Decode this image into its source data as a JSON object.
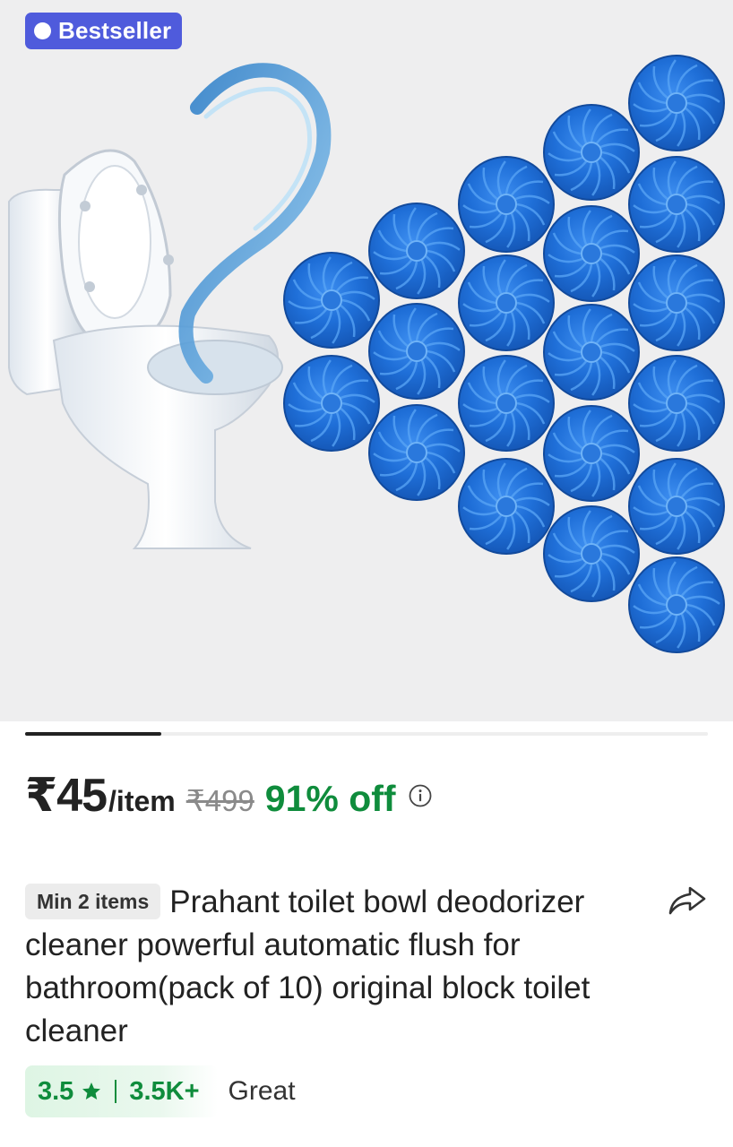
{
  "badge": {
    "label": "Bestseller",
    "icon": "verified-check-icon",
    "color": "#4f5bdc"
  },
  "gallery": {
    "current_index": 1,
    "image_count": 5
  },
  "price": {
    "current": "₹45",
    "unit": "/item",
    "mrp": "₹499",
    "discount": "91% off",
    "info_icon": "info-icon",
    "discount_color": "#0f8c3c"
  },
  "product": {
    "min_qty_label": "Min 2 items",
    "title": "Prahant toilet bowl deodorizer cleaner powerful automatic flush for bathroom(pack of 10) original block toilet cleaner",
    "share_icon": "share-icon"
  },
  "rating": {
    "score": "3.5",
    "star_icon": "star-icon",
    "count": "3.5K+",
    "label": "Great",
    "color": "#0f8c3c"
  }
}
